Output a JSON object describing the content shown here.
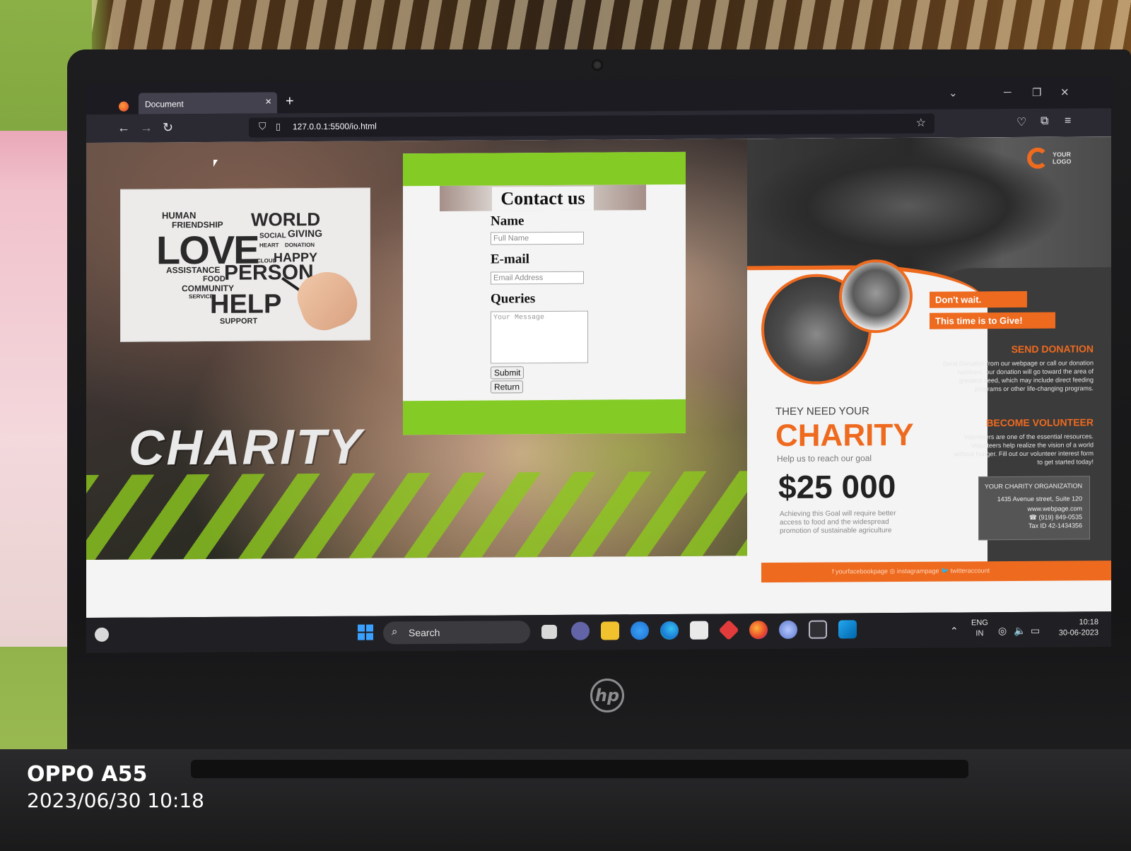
{
  "browser": {
    "tab_title": "Document",
    "tab_close": "×",
    "new_tab": "+",
    "url": "127.0.0.1:5500/io.html",
    "nav": {
      "back": "←",
      "forward": "→",
      "reload": "↻"
    }
  },
  "wordcloud": {
    "words": [
      "LOVE",
      "HUMAN",
      "FRIENDSHIP",
      "WORLD",
      "GIVING",
      "HAPPY",
      "ASSISTANCE",
      "PERSON",
      "COMMUNITY",
      "HELP",
      "SUPPORT",
      "DONATION",
      "FOOD",
      "SOCIAL",
      "CLOUD",
      "SERVICE",
      "HEART"
    ]
  },
  "hero": {
    "title": "CHARITY"
  },
  "contact": {
    "title": "Contact us",
    "name_label": "Name",
    "name_placeholder": "Full Name",
    "email_label": "E-mail",
    "email_placeholder": "Email Address",
    "queries_label": "Queries",
    "queries_placeholder": "Your Message",
    "submit_label": "Submit",
    "return_label": "Return"
  },
  "poster": {
    "logo": "YOUR LOGO",
    "tag1": "Don't wait.",
    "tag2": "This time is to Give!",
    "send_heading": "SEND DONATION",
    "send_text": "Send Donation from our webpage or call our donation numbers. our donation will go toward the area of greatest need, which may include direct feeding programs or other life-changing programs.",
    "volunteer_heading": "BECOME VOLUNTEER",
    "volunteer_text": "Volunteers are one of the essential resources. Volunteers help realize the vision of a world without hunger. Fill out our volunteer interest form to get started today!",
    "org_name": "YOUR CHARITY ORGANIZATION",
    "org_address": "1435 Avenue street, Suite 120",
    "org_web": "www.webpage.com",
    "org_phone": "☎ (919) 849-0535",
    "org_tax": "Tax ID 42-1434356",
    "need": "THEY NEED YOUR",
    "charity": "CHARITY",
    "help": "Help us to reach our goal",
    "amount": "$25 000",
    "achieve": "Achieving this Goal will require better access to food and the widespread promotion of sustainable agriculture",
    "footer": "f yourfacebookpage   ◎ instagrampage   🐦 twitteraccount"
  },
  "taskbar": {
    "search": "Search",
    "lang1": "ENG",
    "lang2": "IN",
    "time": "10:18",
    "date": "30-06-2023"
  },
  "photo": {
    "device": "OPPO A55",
    "timestamp": "2023/06/30 10:18",
    "laptop_brand": "hp"
  }
}
